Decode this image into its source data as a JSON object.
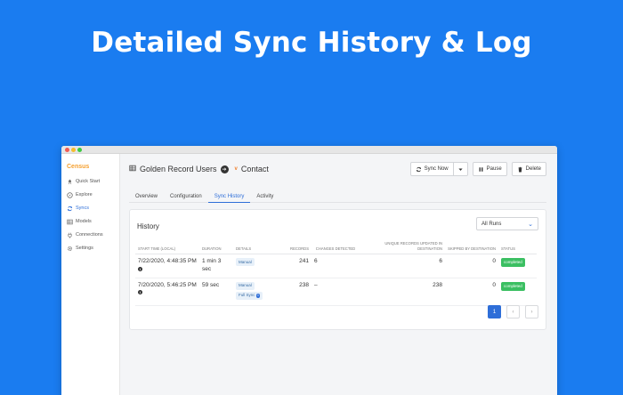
{
  "hero": {
    "title": "Detailed Sync History & Log"
  },
  "sidebar": {
    "brand": "Census",
    "items": [
      {
        "label": "Quick Start",
        "icon": "rocket-icon"
      },
      {
        "label": "Explore",
        "icon": "compass-icon"
      },
      {
        "label": "Syncs",
        "icon": "sync-icon",
        "active": true
      },
      {
        "label": "Models",
        "icon": "table-icon"
      },
      {
        "label": "Connections",
        "icon": "plug-icon"
      },
      {
        "label": "Settings",
        "icon": "gear-icon"
      }
    ]
  },
  "header": {
    "source": "Golden Record Users",
    "destination_mark": "v",
    "destination": "Contact"
  },
  "actions": {
    "sync_now": "Sync Now",
    "pause": "Pause",
    "delete": "Delete"
  },
  "tabs": [
    {
      "label": "Overview"
    },
    {
      "label": "Configuration"
    },
    {
      "label": "Sync History",
      "active": true
    },
    {
      "label": "Activity"
    }
  ],
  "history": {
    "title": "History",
    "filter": "All Runs",
    "columns": {
      "start_time": "Start Time (Local)",
      "duration": "Duration",
      "details": "Details",
      "records": "Records",
      "changes": "Changes Detected",
      "unique": "Unique Records Updated in Destination",
      "skipped": "Skipped by Destination",
      "status": "Status"
    },
    "rows": [
      {
        "start_time": "7/22/2020, 4:48:35 PM",
        "duration": "1 min 3 sec",
        "tags": [
          "Manual"
        ],
        "records": "241",
        "changes": "6",
        "unique": "6",
        "skipped": "0",
        "status": "completed"
      },
      {
        "start_time": "7/20/2020, 5:46:25 PM",
        "duration": "59 sec",
        "tags": [
          "Manual",
          "Full Sync"
        ],
        "records": "238",
        "changes": "–",
        "unique": "238",
        "skipped": "0",
        "status": "completed"
      }
    ],
    "pager": {
      "current": "1",
      "prev": "‹",
      "next": "›"
    }
  },
  "colors": {
    "background": "#1a7cf0",
    "accent": "#2e6ed8",
    "brand": "#f5a030",
    "success": "#3bbf62"
  }
}
